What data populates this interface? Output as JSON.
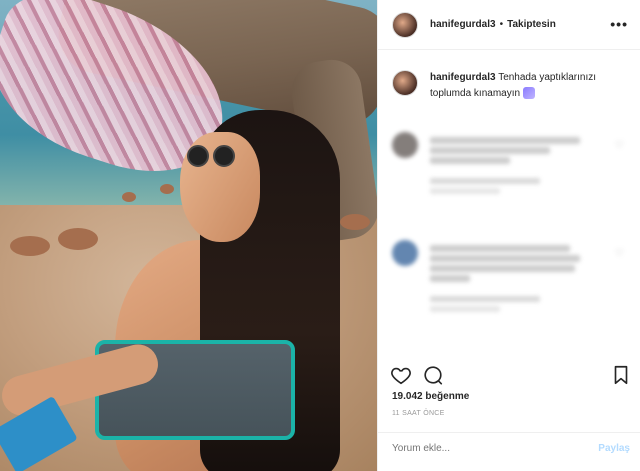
{
  "post": {
    "username": "hanifegurdal3",
    "separator": "•",
    "follow_label": "Takiptesin",
    "more_icon": "more-horizontal-icon",
    "caption_username": "hanifegurdal3",
    "caption_text": "Tenhada yaptıklarınızı toplumda kınamayın",
    "likes": "19.042 beğenme",
    "time": "11 SAAT ÖNCE",
    "comment_placeholder": "Yorum ekle...",
    "post_label": "Paylaş"
  },
  "comments": [
    {
      "text": "",
      "meta": "",
      "avatar_color": "#5b5350"
    },
    {
      "text": "",
      "meta": "",
      "avatar_color": "#2f5e96"
    }
  ],
  "actions": {
    "like_icon": "heart-icon",
    "comment_icon": "comment-icon",
    "save_icon": "bookmark-icon"
  },
  "colors": {
    "accent_blue": "#b3dbff",
    "muted": "#999999",
    "text": "#262626"
  }
}
